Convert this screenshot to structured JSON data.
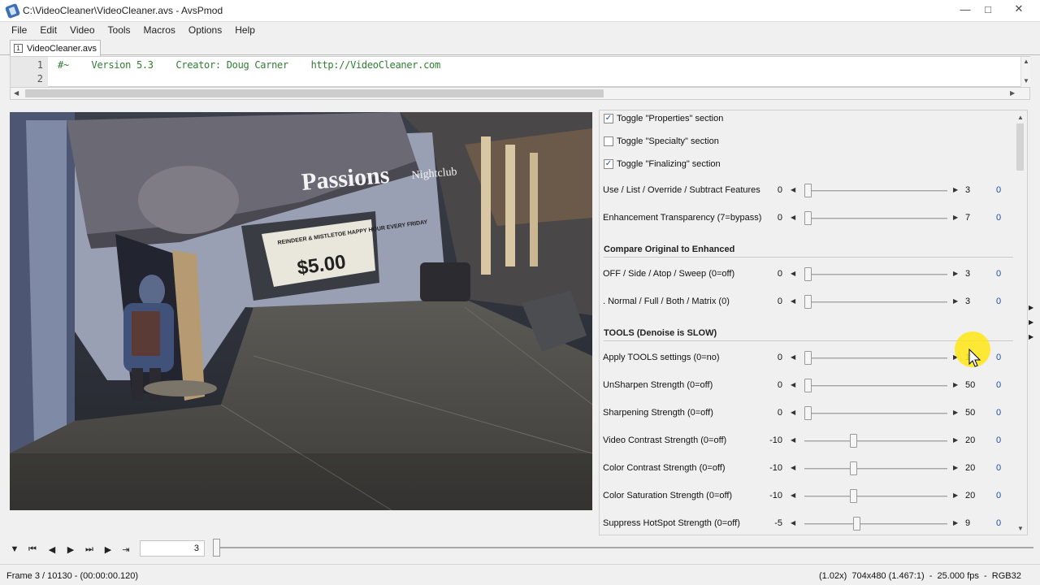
{
  "window": {
    "title": "C:\\VideoCleaner\\VideoCleaner.avs - AvsPmod"
  },
  "menu": [
    "File",
    "Edit",
    "Video",
    "Tools",
    "Macros",
    "Options",
    "Help"
  ],
  "tab": {
    "label": "VideoCleaner.avs",
    "icon_text": "1"
  },
  "editor": {
    "line_numbers": [
      "1",
      "2"
    ],
    "line1": "#~    Version 5.3    Creator: Doug Carner    http://VideoCleaner.com"
  },
  "video_overlay": {
    "sign": "Passions",
    "sign_sub": "Nightclub",
    "poster_top": "REINDEER & MISTLETOE HAPPY HOUR EVERY FRIDAY",
    "poster_price": "$5.00"
  },
  "panel": {
    "toggles": [
      {
        "label": "Toggle \"Properties\" section",
        "checked": true
      },
      {
        "label": "Toggle \"Specialty\" section",
        "checked": false
      },
      {
        "label": "Toggle \"Finalizing\" section",
        "checked": true
      }
    ],
    "rows1": [
      {
        "label": "Use / List / Override / Subtract Features",
        "min": "0",
        "max": "3",
        "value": "0",
        "pos": 0
      },
      {
        "label": "Enhancement Transparency (7=bypass)",
        "min": "0",
        "max": "7",
        "value": "0",
        "pos": 0
      }
    ],
    "section_compare": "Compare Original to Enhanced",
    "rows2": [
      {
        "label": "OFF / Side / Atop / Sweep (0=off)",
        "min": "0",
        "max": "3",
        "value": "0",
        "pos": 0
      },
      {
        "label": ".     Normal / Full / Both / Matrix (0)",
        "min": "0",
        "max": "3",
        "value": "0",
        "pos": 0
      }
    ],
    "section_tools": "TOOLS (Denoise is SLOW)",
    "rows3": [
      {
        "label": "Apply TOOLS settings (0=no)",
        "min": "0",
        "max": "1",
        "value": "0",
        "pos": 0
      },
      {
        "label": "UnSharpen Strength (0=off)",
        "min": "0",
        "max": "50",
        "value": "0",
        "pos": 0
      },
      {
        "label": "Sharpening Strength (0=off)",
        "min": "0",
        "max": "50",
        "value": "0",
        "pos": 0
      },
      {
        "label": "Video Contrast Strength (0=off)",
        "min": "-10",
        "max": "20",
        "value": "0",
        "pos": 0.333
      },
      {
        "label": "Color Contrast Strength (0=off)",
        "min": "-10",
        "max": "20",
        "value": "0",
        "pos": 0.333
      },
      {
        "label": "Color Saturation Strength (0=off)",
        "min": "-10",
        "max": "20",
        "value": "0",
        "pos": 0.333
      },
      {
        "label": "Suppress HotSpot Strength (0=off)",
        "min": "-5",
        "max": "9",
        "value": "0",
        "pos": 0.357
      }
    ]
  },
  "transport": {
    "frame_input": "3"
  },
  "status": {
    "left": "Frame 3 / 10130  -  (00:00:00.120)",
    "right": "(1.02x)  704x480 (1.467:1)  -  25.000 fps  -  RGB32"
  }
}
